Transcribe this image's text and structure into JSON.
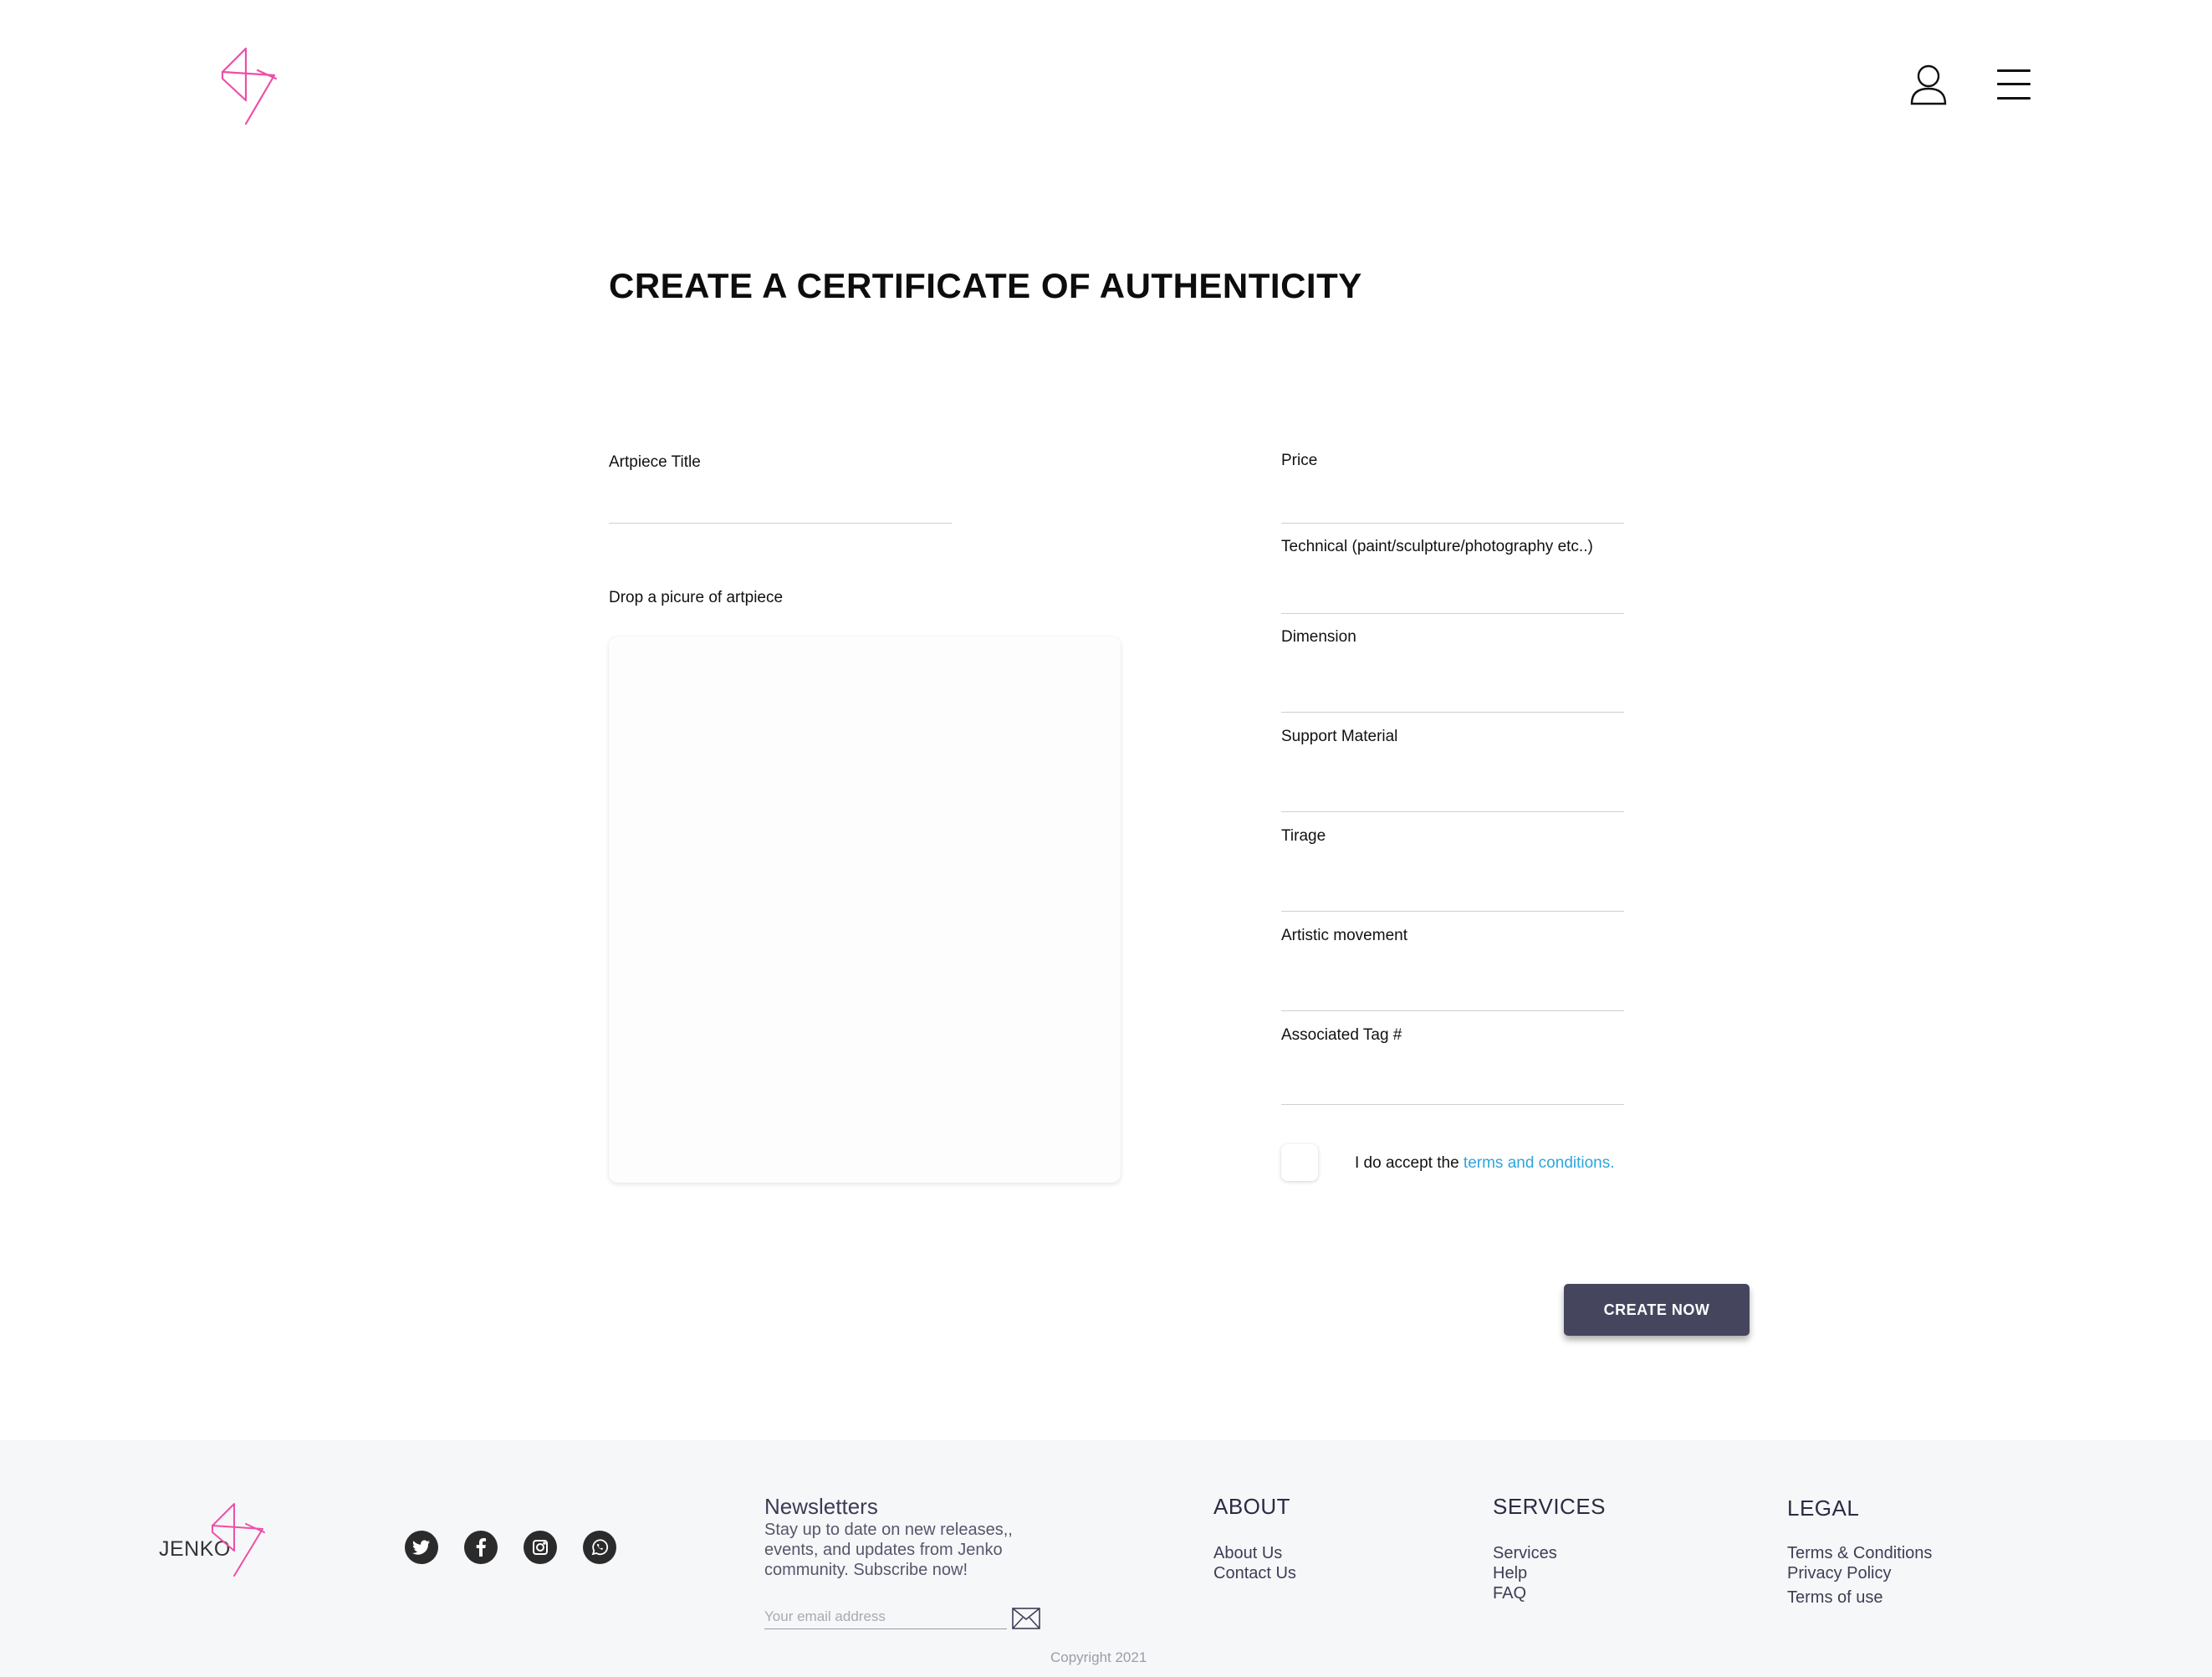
{
  "header": {
    "logo_icon": "jenko-logo-icon",
    "user_icon": "user-icon",
    "menu_icon": "hamburger-menu-icon"
  },
  "page_title": "CREATE A CERTIFICATE OF AUTHENTICITY",
  "form": {
    "artpiece_title_label": "Artpiece Title",
    "artpiece_title_value": "",
    "dropzone_label": "Drop a picure of artpiece",
    "price_label": "Price",
    "price_value": "",
    "technical_label": "Technical (paint/sculpture/photography etc..)",
    "technical_value": "",
    "dimension_label": "Dimension",
    "dimension_value": "",
    "support_material_label": "Support Material",
    "support_material_value": "",
    "tirage_label": "Tirage",
    "tirage_value": "",
    "artistic_movement_label": "Artistic movement",
    "artistic_movement_value": "",
    "associated_tag_label": "Associated Tag #",
    "associated_tag_value": "",
    "accept_text": "I do accept the ",
    "terms_link": "terms and conditions.",
    "accept_checked": false,
    "submit_label": "CREATE NOW"
  },
  "colors": {
    "brand_pink": "#ee4fa6",
    "button_bg": "#45465e",
    "link": "#2ea5dd",
    "footer_bg": "#f6f7f9"
  },
  "footer": {
    "brand": "JENKO",
    "social_icons": [
      "twitter-icon",
      "facebook-icon",
      "instagram-icon",
      "whatsapp-icon"
    ],
    "newsletter_title": "Newsletters",
    "newsletter_text": "Stay up to date on new releases,, events, and updates from Jenko community. Subscribe now!",
    "email_placeholder": "Your email address",
    "about": {
      "title": "ABOUT",
      "links": [
        "About Us",
        "Contact Us"
      ]
    },
    "services": {
      "title": "SERVICES",
      "links": [
        "Services",
        "Help",
        "FAQ"
      ]
    },
    "legal": {
      "title": "LEGAL",
      "links": [
        "Terms & Conditions",
        "Privacy Policy",
        "Terms of use"
      ]
    },
    "copyright": "Copyright 2021"
  }
}
